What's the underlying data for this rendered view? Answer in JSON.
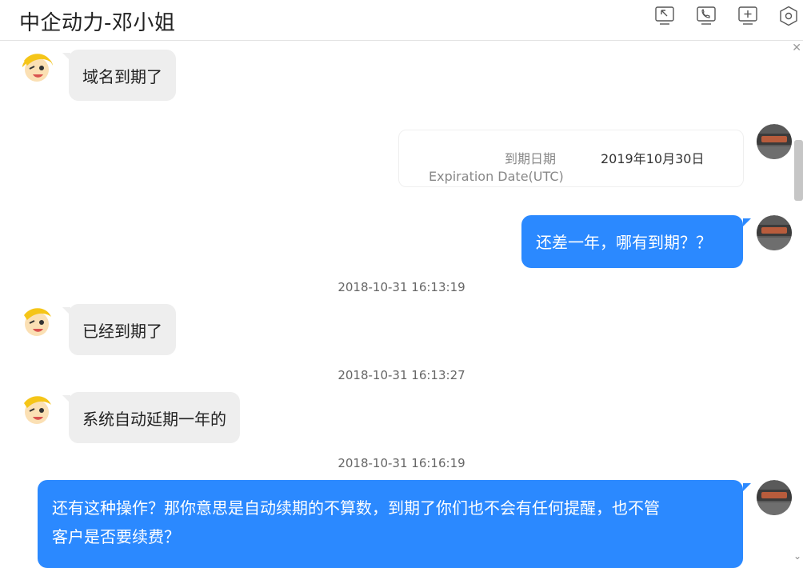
{
  "header": {
    "title": "中企动力-邓小姐"
  },
  "messages": {
    "m1": "域名到期了",
    "card": {
      "label": "到期日期",
      "label_en": "Expiration Date(UTC)",
      "value": "2019年10月30日"
    },
    "m2": "还差一年，哪有到期？？",
    "t1": "2018-10-31 16:13:19",
    "m3": "已经到期了",
    "t2": "2018-10-31 16:13:27",
    "m4": "系统自动延期一年的",
    "t3": "2018-10-31 16:16:19",
    "m5_line1": "还有这种操作？那你意思是自动续期的不算数，到期了你们也不会有任何提醒，也不管",
    "m5_line2": "客户是否要续费？"
  },
  "colors": {
    "accent": "#2b89ff",
    "incoming_bubble": "#eeeeee"
  },
  "icons": [
    "screen-share-icon",
    "phone-icon",
    "add-icon",
    "settings-hexagon-icon",
    "close-icon",
    "chevron-down-icon"
  ]
}
